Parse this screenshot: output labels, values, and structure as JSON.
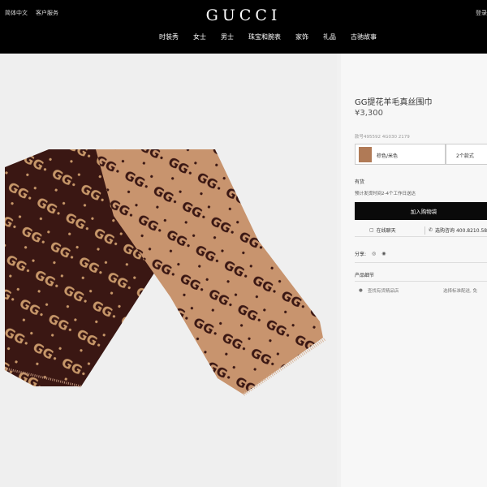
{
  "header": {
    "language": "简体中文",
    "customer_service": "客户服务",
    "login": "登录",
    "logo": "GUCCI",
    "nav": [
      "时装秀",
      "女士",
      "男士",
      "珠宝和腕表",
      "家饰",
      "礼品",
      "古驰故事"
    ]
  },
  "product": {
    "title": "GG提花羊毛真丝围巾",
    "price": "¥3,300",
    "sku": "款号495592 4G030 2179",
    "color": "棕色/米色",
    "size": "2个款式",
    "stock": "有货",
    "shipping": "预计发货时间2-4个工作日送达",
    "add_to_cart": "加入购物袋",
    "chat": "在线聊天",
    "call": "选购咨询 400.8210.582",
    "share_label": "分享:",
    "details_label": "产品细节",
    "store_link": "查找有货精品店",
    "delivery": "选择标准配送, 免"
  },
  "colors": {
    "scarf_brown": "#3a1713",
    "scarf_camel": "#c8946e",
    "logo_tan": "#c79769",
    "logo_dark": "#3a1713",
    "swatch": "#b07a56"
  },
  "icons": {
    "chat": "chat-bubble-icon",
    "call": "phone-icon",
    "wechat": "wechat-icon",
    "weibo": "weibo-icon",
    "pin": "location-pin-icon"
  }
}
